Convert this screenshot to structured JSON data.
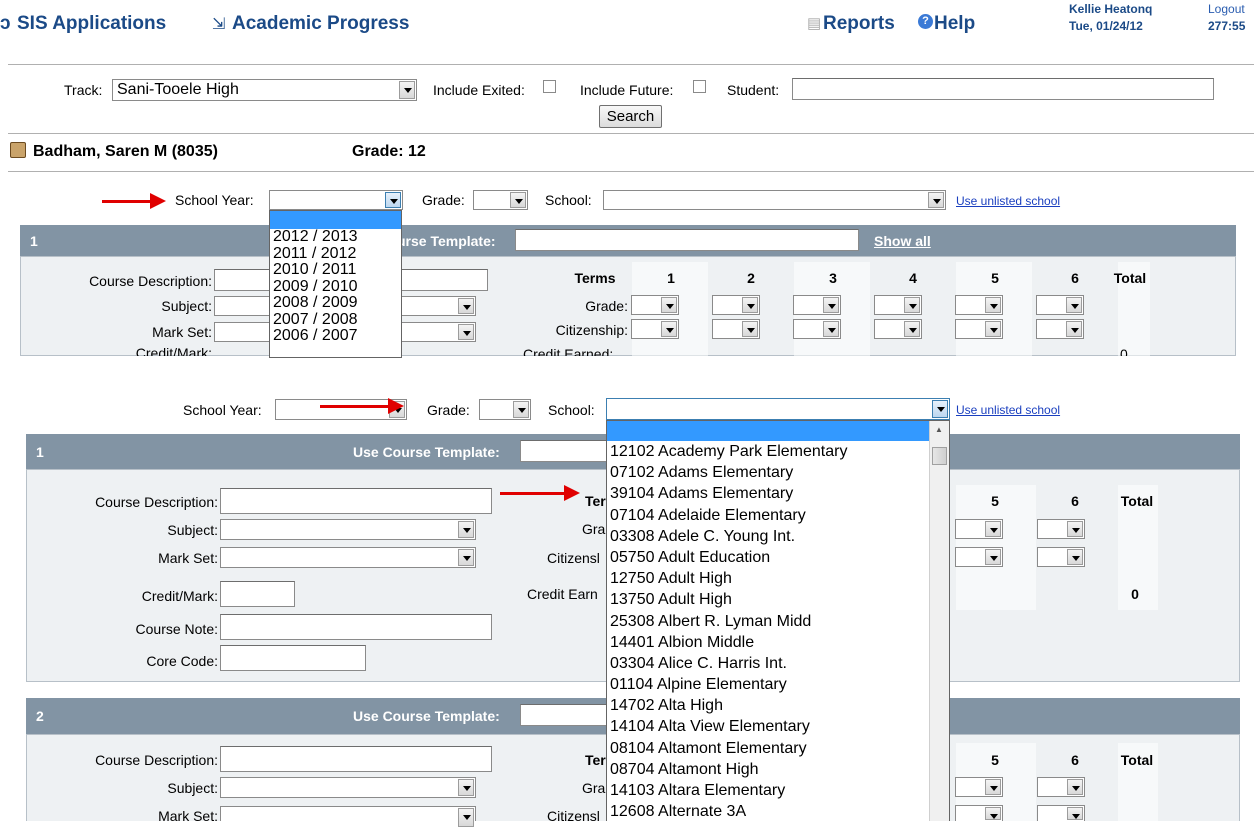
{
  "nav": {
    "sis_label": "SIS Applications",
    "ap_label": "Academic Progress",
    "reports_label": "Reports",
    "help_label": "Help",
    "user_name": "Kellie Heatonq",
    "date": "Tue, 01/24/12",
    "logout_label": "Logout",
    "timer": "277:55"
  },
  "search": {
    "track_label": "Track:",
    "track_value": "Sani-Tooele High",
    "exited_label": "Include Exited:",
    "future_label": "Include Future:",
    "student_label": "Student:",
    "search_button": "Search"
  },
  "student": {
    "name": "Badham, Saren M (8035)",
    "grade": "Grade: 12"
  },
  "filters": {
    "school_year_label": "School Year:",
    "grade_label": "Grade:",
    "school_label": "School:",
    "unlisted_link": "Use unlisted school"
  },
  "sections": [
    {
      "num": "1",
      "template_label": "Use Course Template:",
      "template_short": "urse Template:",
      "show_all": "Show all"
    },
    {
      "num": "2",
      "template_label": "Use Course Template:"
    }
  ],
  "form": {
    "course_description": "Course Description:",
    "subject": "Subject:",
    "mark_set": "Mark Set:",
    "credit_mark": "Credit/Mark:",
    "course_note": "Course Note:",
    "core_code": "Core Code:"
  },
  "terms": {
    "header": "Terms",
    "columns": [
      "1",
      "2",
      "3",
      "4",
      "5",
      "6"
    ],
    "total": "Total",
    "grade_row": "Grade:",
    "citizenship_row": "Citizenship:",
    "credit_earned": "Credit Earned:",
    "credit_total": "0",
    "partial": {
      "ter": "Ter",
      "gra": "Gra",
      "citizensh": "Citizensl",
      "credit_earn": "Credit Earn"
    }
  },
  "school_year_options": [
    "",
    "2012 / 2013",
    "2011 / 2012",
    "2010 / 2011",
    "2009 / 2010",
    "2008 / 2009",
    "2007 / 2008",
    "2006 / 2007"
  ],
  "school_options": [
    "",
    "12102 Academy Park Elementary",
    "07102 Adams Elementary",
    "39104 Adams Elementary",
    "07104 Adelaide Elementary",
    "03308 Adele C. Young Int.",
    "05750 Adult Education",
    "12750 Adult High",
    "13750 Adult High",
    "25308 Albert R. Lyman Midd",
    "14401 Albion Middle",
    "03304 Alice C. Harris Int.",
    "01104 Alpine Elementary",
    "14702 Alta High",
    "14104 Alta View Elementary",
    "08104 Altamont Elementary",
    "08704 Altamont High",
    "14103 Altara Elementary",
    "12608 Alternate 3A"
  ],
  "colors": {
    "nav_text": "#1b4a87",
    "section_bar": "#8294a4",
    "section_body": "#eef1f3",
    "annotation_arrow": "#e00000",
    "dropdown_highlight": "#3399ff"
  }
}
